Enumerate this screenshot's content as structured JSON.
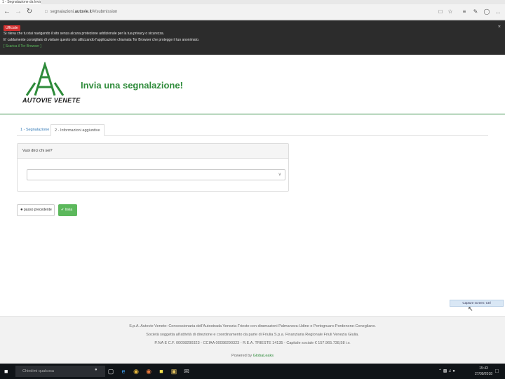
{
  "browser": {
    "tab_title": "1 - Segnalazione da Invia",
    "url_prefix": "segnalazioni.",
    "url_domain": "autovie.it",
    "url_suffix": "/#/submission",
    "back_icon": "arrow-left",
    "forward_icon": "arrow-right",
    "refresh_icon": "refresh",
    "lock_icon": "lock"
  },
  "banner": {
    "badge": "Ufficiale",
    "line1": "Si rileva che tu stai navigando il sito senza alcuna protezione addizionale per la tua privacy o sicurezza.",
    "line2": "E' caldamente consigliato di visitare questo sito utilizzando l'applicazione chiamata Tor Browser che protegge il tuo anonimato.",
    "link": "[ Scarica il Tor Browser ]",
    "close": "×"
  },
  "header": {
    "brand": "AUTOVIE VENETE",
    "title": "Invia una segnalazione!"
  },
  "tabs": [
    {
      "label": "1 - Segnalazione"
    },
    {
      "label": "2 - Informazioni aggiuntive"
    }
  ],
  "panel": {
    "heading": "Vuoi dirci chi sei?",
    "select_value": ""
  },
  "buttons": {
    "prev": "passo precedente",
    "send": "✔ Invia"
  },
  "capture_label": "Capture screen: Ctrl",
  "footer": {
    "line1": "S.p.A. Autovie Venete: Concessionaria dell'Autostrada Venezia-Trieste con diramazioni Palmanova-Udine e Portogruaro-Pordenone-Conegliano.",
    "line2": "Società soggetta all'attività di direzione e coordinamento da parte di Friulia S.p.a. Finanziaria Regionale Friuli Venezia Giulia.",
    "line3": "P.IVA E C.F. 00098290323 - CCIAA 00098290323 - R.E.A. TRIESTE 14135 - Capitale sociale € 157.965.738,58 i.v.",
    "powered": "Powered by",
    "powered_brand": "GlobaLeaks"
  },
  "taskbar": {
    "search_placeholder": "Chiedimi qualcosa",
    "time": "15:43",
    "date": "27/09/2018",
    "apps": [
      "task-view",
      "edge",
      "chrome",
      "firefox",
      "notes",
      "explorer",
      "mail",
      "settings"
    ]
  },
  "colors": {
    "brand_green": "#2e8b3a",
    "button_green": "#5cb85c",
    "banner_bg": "#2c2c2c",
    "badge_red": "#d32f2f"
  }
}
